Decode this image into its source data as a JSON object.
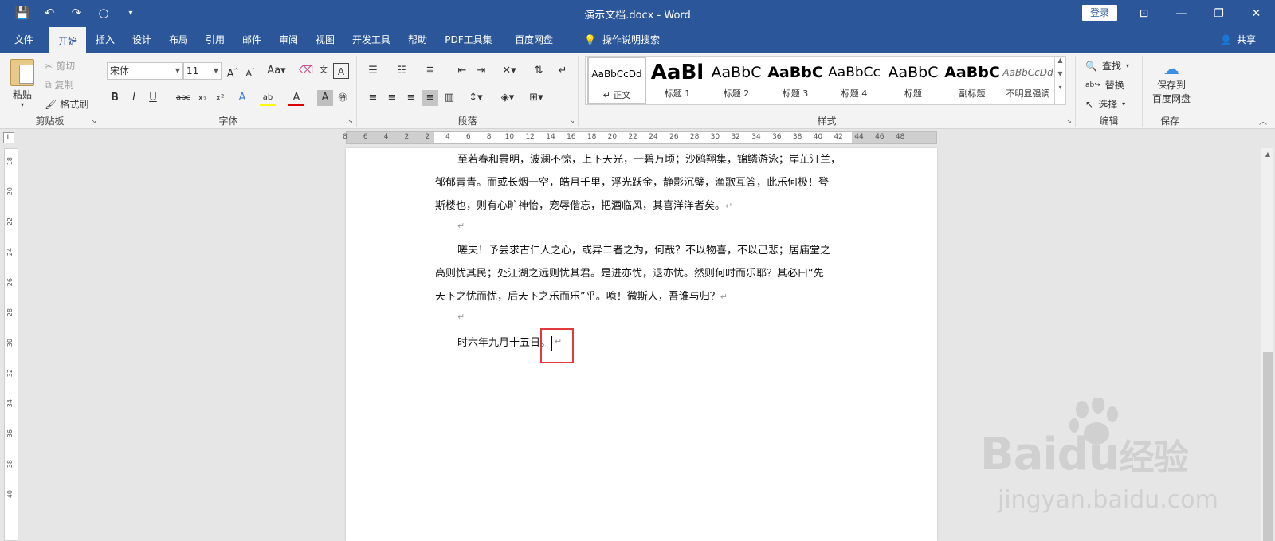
{
  "window": {
    "title": "演示文档.docx - Word",
    "login_label": "登录"
  },
  "tabs": [
    {
      "label": "文件",
      "active": false
    },
    {
      "label": "开始",
      "active": true
    },
    {
      "label": "插入",
      "active": false
    },
    {
      "label": "设计",
      "active": false
    },
    {
      "label": "布局",
      "active": false
    },
    {
      "label": "引用",
      "active": false
    },
    {
      "label": "邮件",
      "active": false
    },
    {
      "label": "审阅",
      "active": false
    },
    {
      "label": "视图",
      "active": false
    },
    {
      "label": "开发工具",
      "active": false
    },
    {
      "label": "帮助",
      "active": false
    },
    {
      "label": "PDF工具集",
      "active": false
    },
    {
      "label": "百度网盘",
      "active": false
    }
  ],
  "tell_me": "操作说明搜索",
  "share": "共享",
  "clipboard": {
    "paste": "粘贴",
    "cut": "剪切",
    "copy": "复制",
    "format_painter": "格式刷",
    "label": "剪贴板"
  },
  "font": {
    "name": "宋体",
    "size": "11",
    "label": "字体"
  },
  "paragraph": {
    "label": "段落"
  },
  "styles": {
    "label": "样式",
    "items": [
      {
        "sample": "AaBbCcDd",
        "name": "↵ 正文"
      },
      {
        "sample": "AaBl",
        "name": "标题 1"
      },
      {
        "sample": "AaBbC",
        "name": "标题 2"
      },
      {
        "sample": "AaBbC",
        "name": "标题 3"
      },
      {
        "sample": "AaBbCc",
        "name": "标题 4"
      },
      {
        "sample": "AaBbC",
        "name": "标题"
      },
      {
        "sample": "AaBbC",
        "name": "副标题"
      },
      {
        "sample": "AaBbCcDd",
        "name": "不明显强调"
      }
    ]
  },
  "editing": {
    "find": "查找",
    "replace": "替换",
    "select": "选择",
    "label": "编辑"
  },
  "save_group": {
    "save_to": "保存到",
    "baidu": "百度网盘",
    "label": "保存"
  },
  "ruler": {
    "ticks": [
      "8",
      "6",
      "4",
      "2",
      "2",
      "4",
      "6",
      "8",
      "10",
      "12",
      "14",
      "16",
      "18",
      "20",
      "22",
      "24",
      "26",
      "28",
      "30",
      "32",
      "34",
      "36",
      "38",
      "40",
      "42",
      "44",
      "46",
      "48"
    ],
    "vticks": [
      "18",
      "20",
      "22",
      "24",
      "26",
      "28",
      "30",
      "32",
      "34",
      "36",
      "38",
      "40"
    ]
  },
  "document": {
    "para1": [
      "至若春和景明，波澜不惊，上下天光，一碧万顷；沙鸥翔集，锦鳞游泳；岸芷汀兰，",
      "郁郁青青。而或长烟一空，皓月千里，浮光跃金，静影沉璧，渔歌互答，此乐何极！登",
      "斯楼也，则有心旷神怡，宠辱偕忘，把酒临风，其喜洋洋者矣。"
    ],
    "para2": [
      "嗟夫！予尝求古仁人之心，或异二者之为，何哉？不以物喜，不以己悲；居庙堂之",
      "高则忧其民；处江湖之远则忧其君。是进亦忧，退亦忧。然则何时而乐耶？其必曰“先",
      "天下之忧而忧，后天下之乐而乐”乎。噫！微斯人，吾谁与归？"
    ],
    "para3": "时六年九月十五日。",
    "para_mark": "↵"
  },
  "watermark": {
    "line1": "Bai",
    "line1b": "du",
    "line1c": "经验",
    "line2": "jingyan.baidu.com"
  }
}
